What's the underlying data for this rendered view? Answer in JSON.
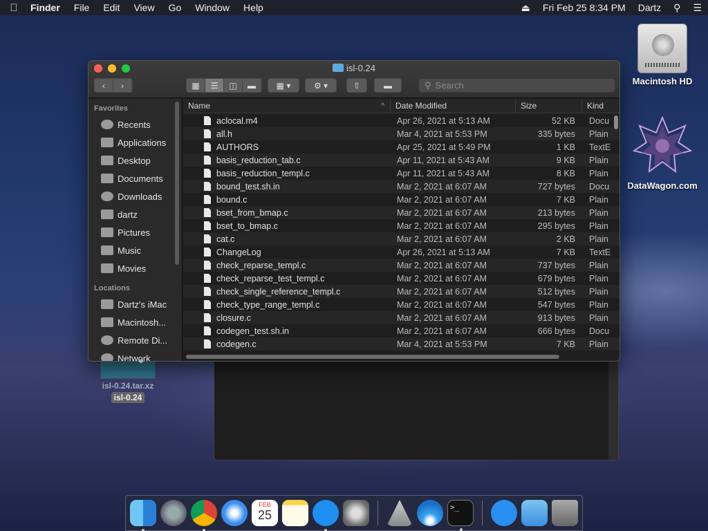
{
  "menubar": {
    "app": "Finder",
    "items": [
      "File",
      "Edit",
      "View",
      "Go",
      "Window",
      "Help"
    ],
    "clock": "Fri Feb 25  8:34 PM",
    "user": "Dartz"
  },
  "desktop": {
    "hd_label": "Macintosh HD",
    "site_label": "DataWagon.com",
    "drag_name": "isl-0.24.tar.xz",
    "drag_rename": "isl-0.24"
  },
  "window": {
    "title": "isl-0.24",
    "search_placeholder": "Search"
  },
  "sidebar": {
    "favorites_header": "Favorites",
    "favorites": [
      {
        "label": "Recents",
        "icon": "recents-icon"
      },
      {
        "label": "Applications",
        "icon": "applications-icon"
      },
      {
        "label": "Desktop",
        "icon": "desktop-icon"
      },
      {
        "label": "Documents",
        "icon": "documents-icon"
      },
      {
        "label": "Downloads",
        "icon": "downloads-icon"
      },
      {
        "label": "dartz",
        "icon": "home-icon"
      },
      {
        "label": "Pictures",
        "icon": "pictures-icon"
      },
      {
        "label": "Music",
        "icon": "music-icon"
      },
      {
        "label": "Movies",
        "icon": "movies-icon"
      }
    ],
    "locations_header": "Locations",
    "locations": [
      {
        "label": "Dartz's iMac",
        "icon": "imac-icon"
      },
      {
        "label": "Macintosh...",
        "icon": "disk-icon"
      },
      {
        "label": "Remote Di...",
        "icon": "remote-disc-icon"
      },
      {
        "label": "Network",
        "icon": "network-icon"
      }
    ]
  },
  "columns": {
    "name": "Name",
    "date": "Date Modified",
    "size": "Size",
    "kind": "Kind"
  },
  "files": [
    {
      "name": "aclocal.m4",
      "date": "Apr 26, 2021 at 5:13 AM",
      "size": "52 KB",
      "kind": "Docu"
    },
    {
      "name": "all.h",
      "date": "Mar 4, 2021 at 5:53 PM",
      "size": "335 bytes",
      "kind": "Plain"
    },
    {
      "name": "AUTHORS",
      "date": "Apr 25, 2021 at 5:49 PM",
      "size": "1 KB",
      "kind": "TextE"
    },
    {
      "name": "basis_reduction_tab.c",
      "date": "Apr 11, 2021 at 5:43 AM",
      "size": "9 KB",
      "kind": "Plain"
    },
    {
      "name": "basis_reduction_templ.c",
      "date": "Apr 11, 2021 at 5:43 AM",
      "size": "8 KB",
      "kind": "Plain"
    },
    {
      "name": "bound_test.sh.in",
      "date": "Mar 2, 2021 at 6:07 AM",
      "size": "727 bytes",
      "kind": "Docu"
    },
    {
      "name": "bound.c",
      "date": "Mar 2, 2021 at 6:07 AM",
      "size": "7 KB",
      "kind": "Plain"
    },
    {
      "name": "bset_from_bmap.c",
      "date": "Mar 2, 2021 at 6:07 AM",
      "size": "213 bytes",
      "kind": "Plain"
    },
    {
      "name": "bset_to_bmap.c",
      "date": "Mar 2, 2021 at 6:07 AM",
      "size": "295 bytes",
      "kind": "Plain"
    },
    {
      "name": "cat.c",
      "date": "Mar 2, 2021 at 6:07 AM",
      "size": "2 KB",
      "kind": "Plain"
    },
    {
      "name": "ChangeLog",
      "date": "Apr 26, 2021 at 5:13 AM",
      "size": "7 KB",
      "kind": "TextE"
    },
    {
      "name": "check_reparse_templ.c",
      "date": "Mar 2, 2021 at 6:07 AM",
      "size": "737 bytes",
      "kind": "Plain"
    },
    {
      "name": "check_reparse_test_templ.c",
      "date": "Mar 2, 2021 at 6:07 AM",
      "size": "679 bytes",
      "kind": "Plain"
    },
    {
      "name": "check_single_reference_templ.c",
      "date": "Mar 2, 2021 at 6:07 AM",
      "size": "512 bytes",
      "kind": "Plain"
    },
    {
      "name": "check_type_range_templ.c",
      "date": "Mar 2, 2021 at 6:07 AM",
      "size": "547 bytes",
      "kind": "Plain"
    },
    {
      "name": "closure.c",
      "date": "Mar 2, 2021 at 6:07 AM",
      "size": "913 bytes",
      "kind": "Plain"
    },
    {
      "name": "codegen_test.sh.in",
      "date": "Mar 2, 2021 at 6:07 AM",
      "size": "666 bytes",
      "kind": "Docu"
    },
    {
      "name": "codegen.c",
      "date": "Mar 4, 2021 at 5:53 PM",
      "size": "7 KB",
      "kind": "Plain"
    }
  ],
  "dock": {
    "calendar_month": "FEB",
    "calendar_day": "25",
    "apps": [
      "finder-icon",
      "launchpad-icon",
      "chrome-icon",
      "safari-icon",
      "calendar-icon",
      "notes-icon",
      "app-store-icon",
      "system-preferences-icon",
      "xquartz-icon",
      "wifi-diagnostics-icon",
      "terminal-icon",
      "app-store-downloads-icon",
      "documents-folder-icon",
      "trash-icon"
    ],
    "terminal_prompt": ">_"
  }
}
